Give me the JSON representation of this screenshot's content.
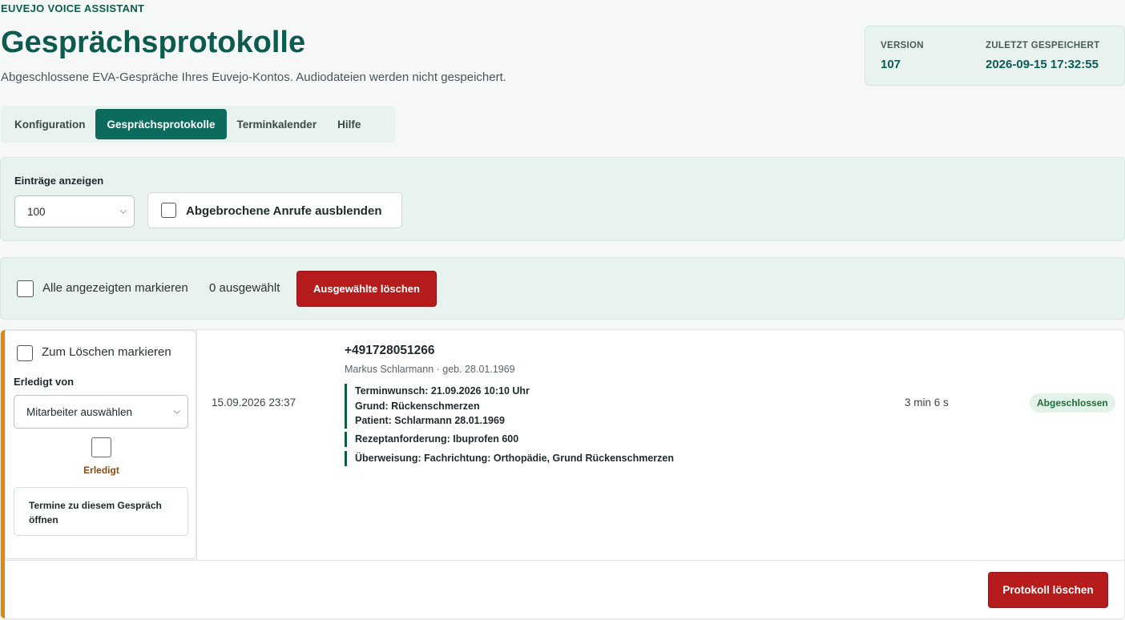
{
  "app": {
    "eyebrow": "EUVEJO VOICE ASSISTANT",
    "title": "Gesprächsprotokolle",
    "subtitle": "Abgeschlossene EVA-Gespräche Ihres Euvejo-Kontos. Audiodateien werden nicht gespeichert."
  },
  "meta": {
    "version_label": "VERSION",
    "version_value": "107",
    "saved_label": "ZULETZT GESPEICHERT",
    "saved_value": "2026-09-15 17:32:55"
  },
  "tabs": [
    {
      "label": "Konfiguration",
      "active": false
    },
    {
      "label": "Gesprächsprotokolle",
      "active": true
    },
    {
      "label": "Terminkalender",
      "active": false
    },
    {
      "label": "Hilfe",
      "active": false
    }
  ],
  "filter": {
    "entries_label": "Einträge anzeigen",
    "entries_value": "100",
    "hide_aborted_label": "Abgebrochene Anrufe ausblenden",
    "hide_aborted_checked": false
  },
  "bulk": {
    "select_all_label": "Alle angezeigten markieren",
    "selected_count": "0 ausgewählt",
    "delete_selected_label": "Ausgewählte löschen"
  },
  "protocol": {
    "mark_delete_label": "Zum Löschen markieren",
    "done_by_label": "Erledigt von",
    "employee_select_value": "Mitarbeiter auswählen",
    "done_label": "Erledigt",
    "appointments_button": "Termine zu diesem Gespräch öffnen",
    "date": "15.09.2026 23:37",
    "phone": "+491728051266",
    "caller": "Markus Schlarmann · geb. 28.01.1969",
    "notes": [
      [
        "Terminwunsch: 21.09.2026 10:10 Uhr",
        "Grund: Rückenschmerzen",
        "Patient: Schlarmann 28.01.1969"
      ],
      [
        "Rezeptanforderung: Ibuprofen 600"
      ],
      [
        "Überweisung: Fachrichtung: Orthopädie, Grund Rückenschmerzen"
      ]
    ],
    "duration": "3 min 6 s",
    "status": "Abgeschlossen",
    "delete_button": "Protokoll löschen"
  },
  "colors": {
    "brand": "#0d5a4f",
    "tab_active": "#0d6b5e",
    "danger": "#b71c1c",
    "accent_stripe": "#e08a0c"
  },
  "icons": {
    "select_chevron": "chevron-down-icon"
  }
}
